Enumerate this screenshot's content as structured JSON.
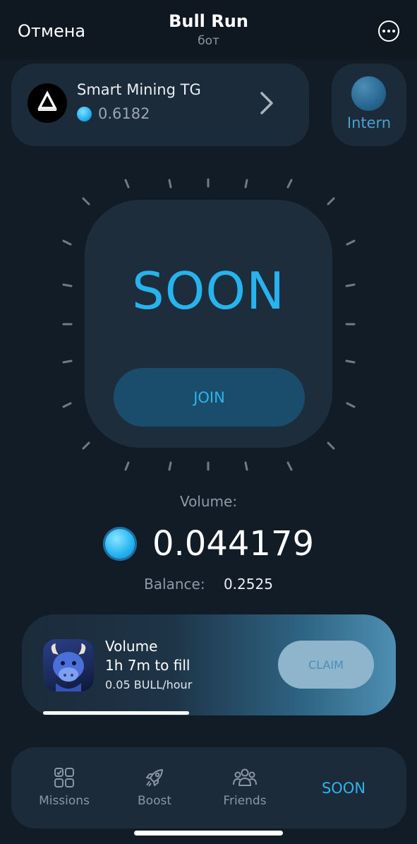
{
  "header": {
    "cancel_label": "Отмена",
    "title": "Bull Run",
    "subtitle": "бот",
    "more_icon": "ellipsis-circle-icon"
  },
  "mining_card": {
    "name": "Smart Mining TG",
    "value": "0.6182",
    "coin_icon": "coin-icon",
    "chevron_icon": "chevron-right-icon"
  },
  "intern": {
    "label": "Intern"
  },
  "center": {
    "status_text": "SOON",
    "join_label": "JOIN"
  },
  "volume": {
    "label": "Volume:",
    "value": "0.044179"
  },
  "balance": {
    "label": "Balance:",
    "value": "0.2525"
  },
  "claim_card": {
    "title": "Volume",
    "fill_time": "1h 7m to fill",
    "rate": "0.05 BULL/hour",
    "claim_label": "CLAIM",
    "progress_fraction": 0.39
  },
  "nav": {
    "items": [
      {
        "label": "Missions",
        "icon": "missions-grid-icon"
      },
      {
        "label": "Boost",
        "icon": "rocket-icon"
      },
      {
        "label": "Friends",
        "icon": "friends-group-icon"
      }
    ],
    "active_label": "SOON"
  },
  "colors": {
    "background": "#111c27",
    "card": "#1c2b3a",
    "accent": "#27b4ee",
    "muted_text": "#8a96a3"
  }
}
